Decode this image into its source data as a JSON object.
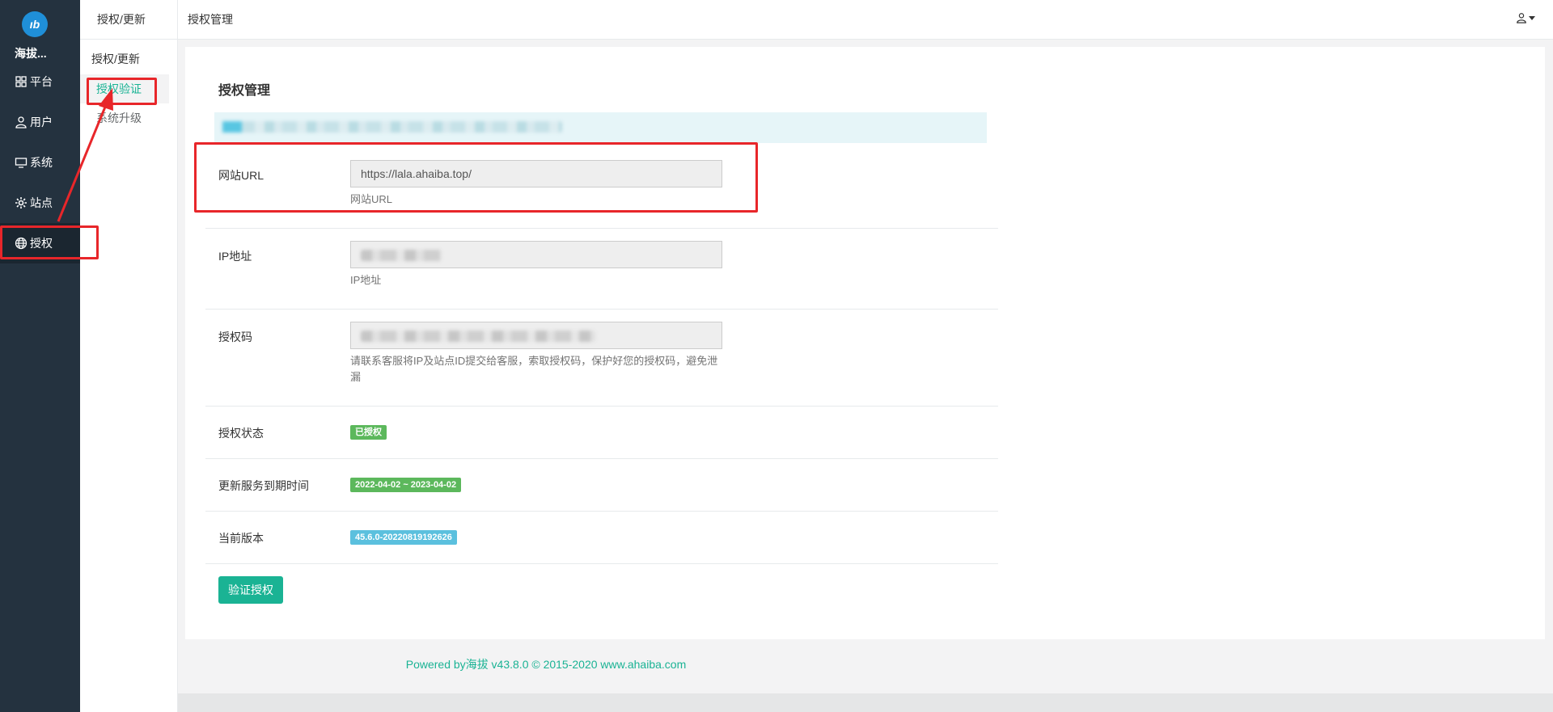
{
  "app": {
    "logo_text": "ıb",
    "brand": "海拔..."
  },
  "sidebar": {
    "items": [
      {
        "label": "平台",
        "icon": "grid-icon"
      },
      {
        "label": "用户",
        "icon": "user-icon"
      },
      {
        "label": "系统",
        "icon": "monitor-icon"
      },
      {
        "label": "站点",
        "icon": "gear-icon"
      },
      {
        "label": "授权",
        "icon": "globe-icon",
        "active": true
      }
    ]
  },
  "subnav": {
    "header": "授权/更新",
    "group": "授权/更新",
    "items": [
      {
        "label": "授权验证",
        "active": true
      },
      {
        "label": "系统升级"
      }
    ]
  },
  "topbar": {
    "title": "授权管理",
    "user_icon": "user-dropdown-icon"
  },
  "panel": {
    "title": "授权管理",
    "fields": {
      "url": {
        "label": "网站URL",
        "value": "https://lala.ahaiba.top/",
        "hint": "网站URL"
      },
      "ip": {
        "label": "IP地址",
        "hint": "IP地址"
      },
      "code": {
        "label": "授权码",
        "hint": "请联系客服将IP及站点ID提交给客服，索取授权码，保护好您的授权码，避免泄漏"
      },
      "status": {
        "label": "授权状态",
        "value": "已授权"
      },
      "expiry": {
        "label": "更新服务到期时间",
        "value": "2022-04-02 ~ 2023-04-02"
      },
      "version": {
        "label": "当前版本",
        "value": "45.6.0-20220819192626"
      }
    },
    "verify_button": "验证授权"
  },
  "footer": {
    "text": "Powered by海拔 v43.8.0 © 2015-2020 www.ahaiba.com"
  },
  "colors": {
    "sidebar_bg": "#24323f",
    "accent": "#1ab394",
    "badge_green": "#5cb85c",
    "badge_teal": "#5bc0de",
    "annotation_red": "#e8262a"
  }
}
